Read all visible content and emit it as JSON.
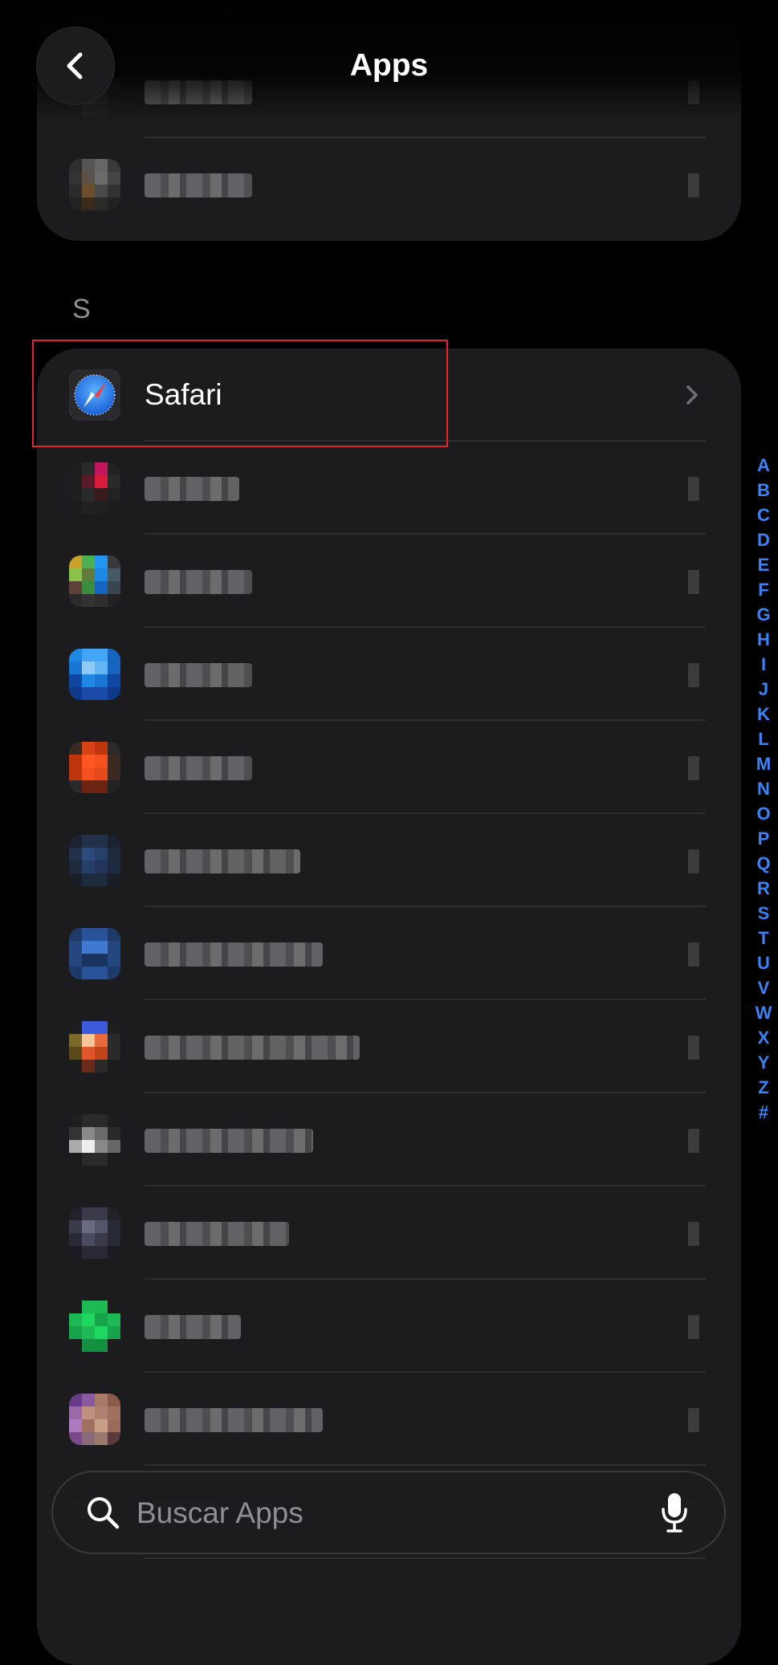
{
  "header": {
    "title": "Apps"
  },
  "section": {
    "letter": "S"
  },
  "safari": {
    "label": "Safari"
  },
  "index": [
    "A",
    "B",
    "C",
    "D",
    "E",
    "F",
    "G",
    "H",
    "I",
    "J",
    "K",
    "L",
    "M",
    "N",
    "O",
    "P",
    "Q",
    "R",
    "S",
    "T",
    "U",
    "V",
    "W",
    "X",
    "Y",
    "Z",
    "#"
  ],
  "search": {
    "placeholder": "Buscar Apps"
  },
  "colors": {
    "accent": "#3b82f6",
    "highlight": "#e0262c",
    "card": "#1c1c1e"
  },
  "icons": {
    "back": "chevron-left-icon",
    "search": "magnifier-icon",
    "mic": "microphone-icon",
    "safari": "compass-icon",
    "chevron": "chevron-right-icon"
  }
}
